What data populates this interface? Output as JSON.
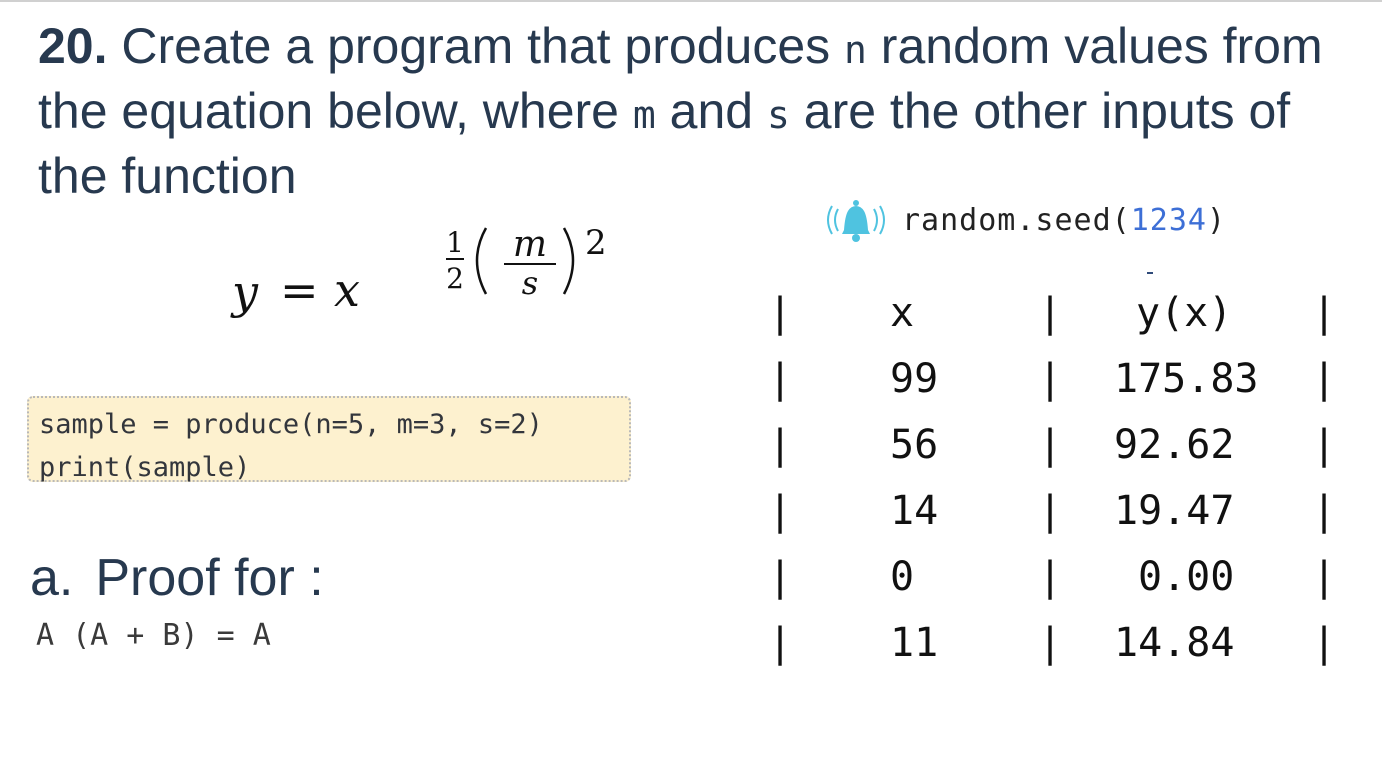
{
  "question": {
    "number": "20.",
    "part1": " Create a program that produces ",
    "var_n": "n",
    "part2": " random values from the equation below, where ",
    "var_m": "m",
    "part3": " and ",
    "var_s": "s",
    "part4": " are the other inputs of the function"
  },
  "equation": {
    "lhs": "y",
    "equals": "=",
    "base": "x",
    "frac_num": "1",
    "frac_den": "2",
    "inner_num": "m",
    "inner_den": "s",
    "power": "2"
  },
  "seed": {
    "icon": "bell-ringing-icon",
    "icon_color": "#4fc3e0",
    "prefix": "random.seed(",
    "value": "1234",
    "suffix": ")"
  },
  "code": {
    "line1": "sample = produce(n=5, m=3, s=2)",
    "line2": "print(sample)"
  },
  "proof": {
    "letter": "a.",
    "heading": "Proof for :",
    "expression": "A (A + B) = A"
  },
  "table": {
    "separator": "|",
    "headers": [
      "x",
      "y(x)"
    ],
    "rows": [
      [
        "99",
        "175.83"
      ],
      [
        "56",
        "92.62"
      ],
      [
        "14",
        "19.47"
      ],
      [
        "0",
        "0.00"
      ],
      [
        "11",
        "14.84"
      ]
    ]
  }
}
